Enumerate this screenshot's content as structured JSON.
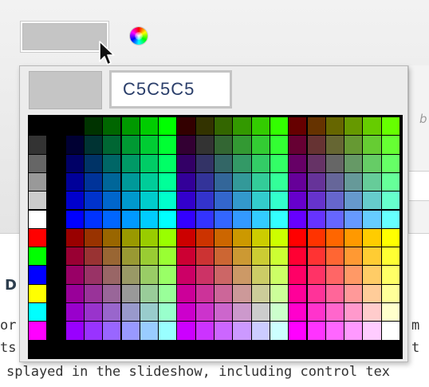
{
  "color_field": {
    "current_color": "#C5C5C5",
    "wheel_icon": "color-wheel-icon"
  },
  "picker": {
    "hex_value": "C5C5C5",
    "preview_color": "#C5C5C5"
  },
  "background_page": {
    "hint_char": "b",
    "heading_char": "D",
    "left_fragments": [
      "or",
      "ts"
    ],
    "right_fragments": [
      "m",
      "t"
    ],
    "bottom_line": "splayed in the slideshow, including control tex"
  }
}
